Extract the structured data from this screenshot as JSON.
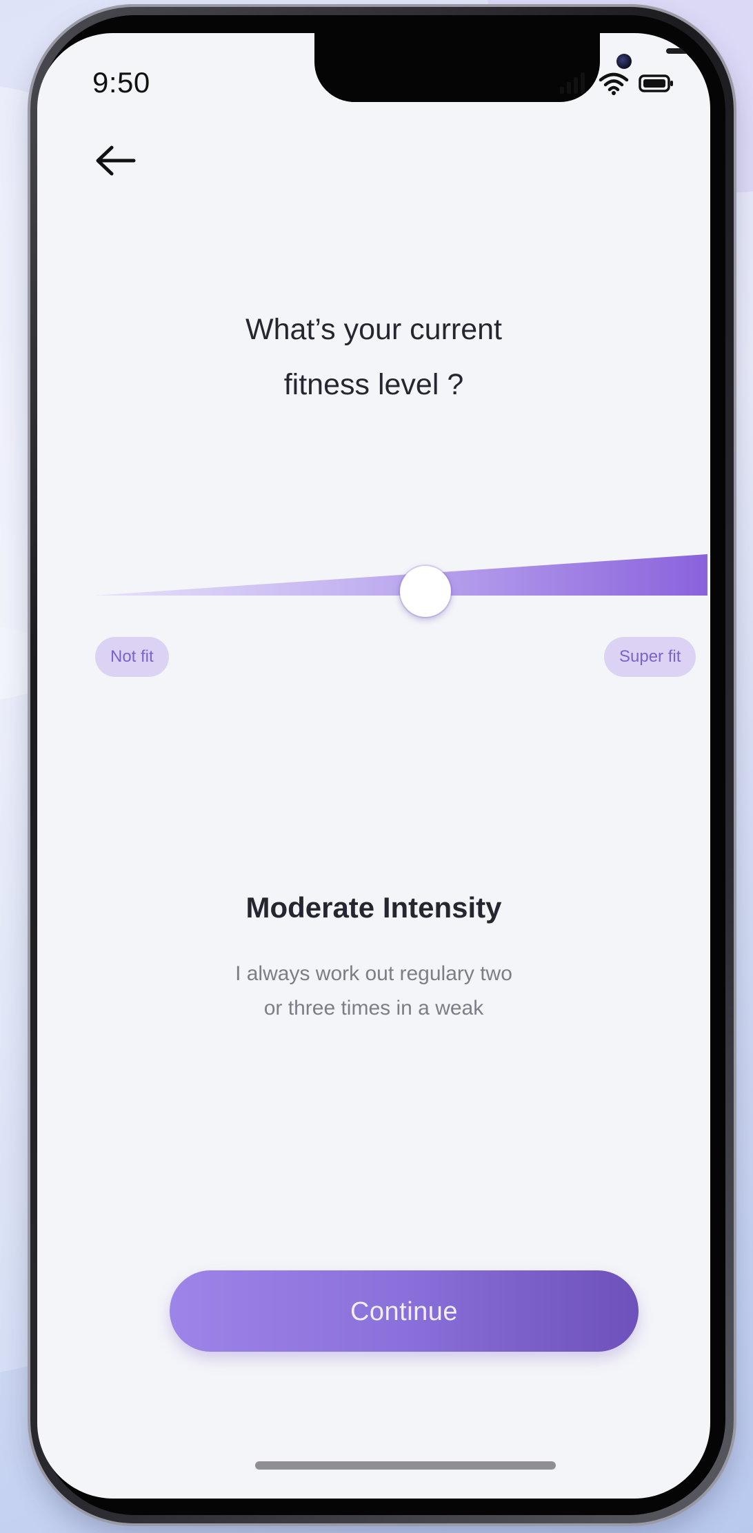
{
  "status_bar": {
    "time": "9:50",
    "icons": [
      "signal-icon",
      "wifi-icon",
      "battery-icon"
    ]
  },
  "nav": {
    "back_icon": "arrow-left-icon"
  },
  "question": {
    "line1": "What’s your current",
    "line2": "fitness level ?"
  },
  "slider": {
    "value": 0.54,
    "min_label": "Not fit",
    "max_label": "Super fit"
  },
  "selection": {
    "title": "Moderate Intensity",
    "description_line1": "I always  work out regulary two",
    "description_line2": "or three times in a weak"
  },
  "continue_button": {
    "label": "Continue"
  },
  "colors": {
    "accent": "#8a70da",
    "accent_dark": "#6e51bb",
    "pill_bg": "#dcd3f4",
    "pill_text": "#7b63c9",
    "screen_bg": "#f4f5f9"
  }
}
